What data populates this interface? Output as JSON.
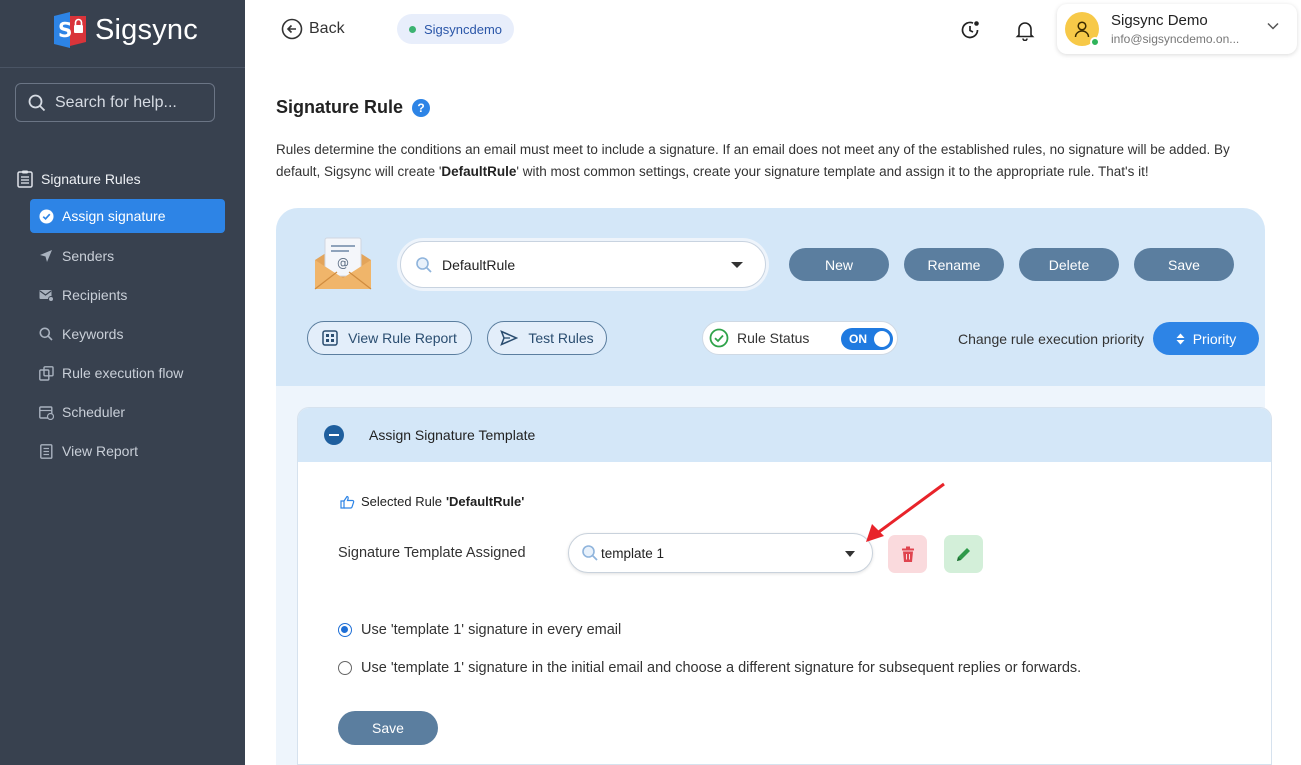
{
  "app": {
    "name": "Sigsync",
    "brand_color": "#2d84e6"
  },
  "sidebar": {
    "search_placeholder": "Search for help...",
    "group_label": "Signature Rules",
    "items": [
      {
        "label": "Assign signature",
        "icon": "check-circle-icon",
        "active": true
      },
      {
        "label": "Senders",
        "icon": "send-icon"
      },
      {
        "label": "Recipients",
        "icon": "recipients-icon"
      },
      {
        "label": "Keywords",
        "icon": "search-icon"
      },
      {
        "label": "Rule execution flow",
        "icon": "flow-icon"
      },
      {
        "label": "Scheduler",
        "icon": "calendar-icon"
      },
      {
        "label": "View Report",
        "icon": "report-icon"
      }
    ]
  },
  "header": {
    "back_label": "Back",
    "tenant": "Sigsyncdemo",
    "user": {
      "name": "Sigsync Demo",
      "email": "info@sigsyncdemo.on..."
    }
  },
  "page": {
    "title": "Signature Rule",
    "help": "?",
    "desc_1": "Rules determine the conditions an email must meet to include a signature. If an email does not meet any of the established rules, no signature will be added. By default, Sigsync will create '",
    "desc_bold": "DefaultRule",
    "desc_2": "' with most common settings, create your signature template and assign it to the appropriate rule. That's it!"
  },
  "rule_toolbar": {
    "selected_rule": "DefaultRule",
    "buttons": {
      "new": "New",
      "rename": "Rename",
      "delete": "Delete",
      "save": "Save"
    },
    "view_report": "View Rule Report",
    "test_rules": "Test Rules",
    "status_label": "Rule Status",
    "status_value": "ON",
    "priority_label": "Change rule execution priority",
    "priority_button": "Priority"
  },
  "assign": {
    "header": "Assign Signature Template",
    "selected_prefix": "Selected Rule",
    "selected_rule": "'DefaultRule'",
    "template_label": "Signature Template Assigned",
    "template_value": "template 1",
    "option_1": "Use 'template 1' signature in every email",
    "option_2": "Use 'template 1' signature in the initial email and choose a different signature for subsequent replies or forwards.",
    "selected_option": 1,
    "save": "Save"
  }
}
